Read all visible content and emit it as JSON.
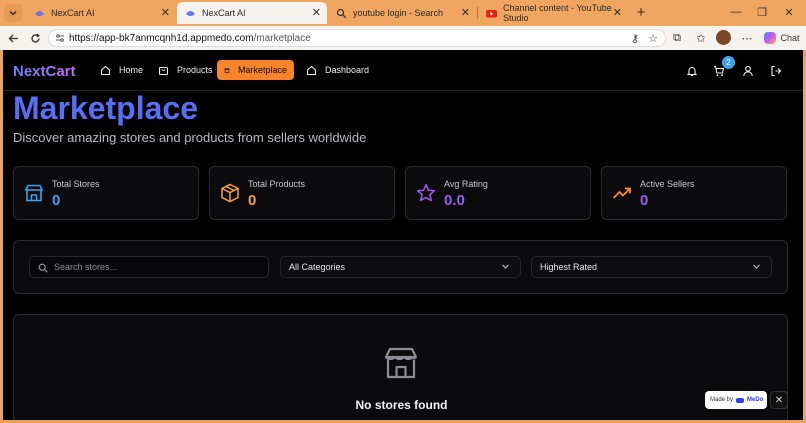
{
  "browser": {
    "tabs": [
      {
        "title": "NexCart AI",
        "active": false
      },
      {
        "title": "NexCart AI",
        "active": true
      },
      {
        "title": "youtube login - Search",
        "active": false
      },
      {
        "title": "Channel content - YouTube Studio",
        "active": false
      }
    ],
    "url_host": "https://app-bk7anmcqnh1d.appmedo.com",
    "url_path": "/marketplace",
    "chat_label": "Chat"
  },
  "nav": {
    "logo": "NextCart",
    "items": [
      {
        "label": "Home",
        "icon": "home-icon"
      },
      {
        "label": "Products",
        "icon": "bag-icon"
      },
      {
        "label": "Marketplace",
        "icon": "store-icon"
      },
      {
        "label": "Dashboard",
        "icon": "home-icon"
      }
    ],
    "cart_count": "2"
  },
  "page": {
    "title": "Marketplace",
    "subtitle": "Discover amazing stores and products from sellers worldwide"
  },
  "stats": [
    {
      "label": "Total Stores",
      "value": "0",
      "color": "#3aa3f2",
      "icon": "store-icon"
    },
    {
      "label": "Total Products",
      "value": "0",
      "color": "#f5a13a",
      "icon": "package-icon"
    },
    {
      "label": "Avg Rating",
      "value": "0.0",
      "color": "#9b5cf0",
      "icon": "star-icon"
    },
    {
      "label": "Active Sellers",
      "value": "0",
      "color": "#f58a3a",
      "icon": "trending-up-icon"
    }
  ],
  "filters": {
    "search_placeholder": "Search stores...",
    "category": "All Categories",
    "sort": "Highest Rated"
  },
  "empty": {
    "title": "No stores found"
  },
  "badge": {
    "made_by": "Made by",
    "brand": "MeDo"
  }
}
